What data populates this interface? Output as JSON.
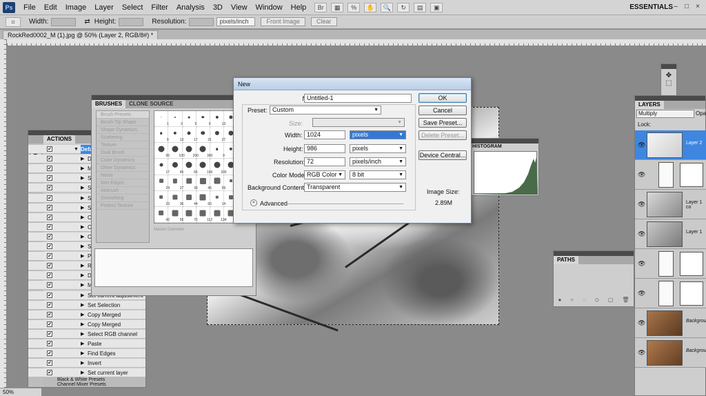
{
  "app": {
    "logo": "Ps",
    "menu": [
      "File",
      "Edit",
      "Image",
      "Layer",
      "Select",
      "Filter",
      "Analysis",
      "3D",
      "View",
      "Window",
      "Help"
    ],
    "workspace": "ESSENTIALS",
    "window_buttons": [
      "–",
      "□",
      "×"
    ]
  },
  "options": {
    "width_label": "Width:",
    "height_label": "Height:",
    "resolution_label": "Resolution:",
    "resolution_unit": "pixels/inch",
    "front_image": "Front Image",
    "clear": "Clear"
  },
  "document": {
    "tab": "RockRed0002_M (1).jpg @ 50% (Layer 2, RGB/8#) *",
    "zoom": "50%"
  },
  "actions": {
    "tab": "ACTIONS",
    "items": [
      {
        "label": "Default Actions",
        "checked": true,
        "expanded": true
      },
      {
        "label": "D",
        "checked": true
      },
      {
        "label": "M",
        "checked": true
      },
      {
        "label": "S",
        "checked": true
      },
      {
        "label": "S",
        "checked": true
      },
      {
        "label": "S",
        "checked": true
      },
      {
        "label": "S",
        "checked": true
      },
      {
        "label": "C",
        "checked": true
      },
      {
        "label": "C",
        "checked": true
      },
      {
        "label": "C",
        "checked": true
      },
      {
        "label": "S",
        "checked": true
      },
      {
        "label": "P",
        "checked": true
      },
      {
        "label": "R",
        "checked": true
      },
      {
        "label": "D",
        "checked": true
      },
      {
        "label": "M",
        "checked": true
      },
      {
        "label": "Set current adjustment l...",
        "checked": true
      },
      {
        "label": "Set Selection",
        "checked": true
      },
      {
        "label": "Copy Merged",
        "checked": true
      },
      {
        "label": "Copy Merged",
        "checked": true
      },
      {
        "label": "Select RGB channel",
        "checked": true
      },
      {
        "label": "Paste",
        "checked": true
      },
      {
        "label": "Find Edges",
        "checked": true
      },
      {
        "label": "Invert",
        "checked": true
      },
      {
        "label": "Set current layer",
        "checked": true
      }
    ],
    "footer": [
      "Black & White Presets",
      "Channel Mixer Presets"
    ]
  },
  "brushes": {
    "tabs": [
      "BRUSHES",
      "CLONE SOURCE"
    ],
    "options": [
      "Brush Presets",
      "Brush Tip Shape",
      "Shape Dynamics",
      "Scattering",
      "Texture",
      "Dual Brush",
      "Color Dynamics",
      "Other Dynamics",
      "Noise",
      "Wet Edges",
      "Airbrush",
      "Smoothing",
      "Protect Texture"
    ],
    "sizes": [
      "1",
      "3",
      "5",
      "9",
      "13",
      "19",
      "5",
      "9",
      "13",
      "17",
      "21",
      "27",
      "35",
      "45",
      "65",
      "100",
      "200",
      "300",
      "9",
      "13",
      "19",
      "17",
      "45",
      "65",
      "100",
      "200",
      "300",
      "14",
      "24",
      "27",
      "39",
      "46",
      "59",
      "11",
      "17",
      "23",
      "36",
      "44",
      "60",
      "14",
      "26",
      "33",
      "42",
      "55",
      "70",
      "112",
      "134",
      "74"
    ],
    "master_diameter": "Master Diameter"
  },
  "histogram": {
    "title": "HISTOGRAM"
  },
  "paths": {
    "tab": "PATHS"
  },
  "layers": {
    "tab": "LAYERS",
    "blend_mode": "Multiply",
    "opacity_label": "Opac",
    "lock_label": "Lock:",
    "items": [
      {
        "name": "Layer 2",
        "active": true
      },
      {
        "name": "",
        "active": false
      },
      {
        "name": "Layer 1 co",
        "active": false
      },
      {
        "name": "Layer 1",
        "active": false
      },
      {
        "name": "",
        "active": false
      },
      {
        "name": "",
        "active": false
      },
      {
        "name": "Backgrou",
        "active": false
      },
      {
        "name": "Backgrou",
        "active": false
      }
    ]
  },
  "dialog": {
    "title": "New",
    "name_label": "Name:",
    "name_value": "Untitled-1",
    "preset_label": "Preset:",
    "preset_value": "Custom",
    "size_label": "Size:",
    "width_label": "Width:",
    "width_value": "1024",
    "width_unit": "pixels",
    "height_label": "Height:",
    "height_value": "986",
    "height_unit": "pixels",
    "resolution_label": "Resolution:",
    "resolution_value": "72",
    "resolution_unit": "pixels/inch",
    "color_mode_label": "Color Mode:",
    "color_mode_value": "RGB Color",
    "bit_depth": "8 bit",
    "background_label": "Background Contents:",
    "background_value": "Transparent",
    "advanced_label": "Advanced",
    "ok": "OK",
    "cancel": "Cancel",
    "save_preset": "Save Preset...",
    "delete_preset": "Delete Preset...",
    "device_central": "Device Central...",
    "image_size_label": "Image Size:",
    "image_size_value": "2.89M"
  },
  "colors": {
    "accent": "#3478d6",
    "panel_bg": "#cecece",
    "workspace_bg": "#8a8a8a"
  }
}
